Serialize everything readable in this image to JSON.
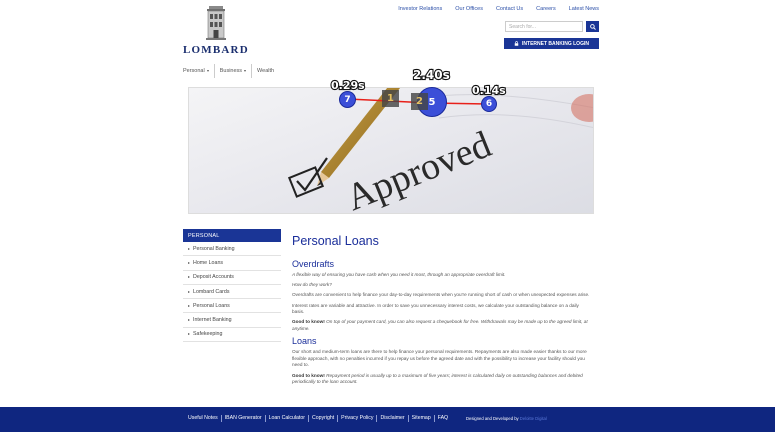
{
  "brand": {
    "logo_text": "LOMBARD"
  },
  "top_links": [
    "Investor Relations",
    "Our Offices",
    "Contact Us",
    "Careers",
    "Latest News"
  ],
  "search": {
    "placeholder": "Search for..."
  },
  "login_button": "INTERNET BANKING LOGIN",
  "main_nav": [
    {
      "label": "Personal",
      "dropdown": true
    },
    {
      "label": "Business",
      "dropdown": true
    },
    {
      "label": "Wealth",
      "dropdown": false
    }
  ],
  "hero": {
    "alt_word": "Approved"
  },
  "overlay": {
    "time_labels": [
      "0.29s",
      "2.40s",
      "0.14s"
    ],
    "marks": [
      "7",
      "1",
      "2",
      "5",
      "6"
    ],
    "line_color": "#e8201a",
    "circle_color": "#3b4fd8"
  },
  "sidebar": {
    "heading": "PERSONAL",
    "items": [
      "Personal Banking",
      "Home Loans",
      "Deposit Accounts",
      "Lombard Cards",
      "Personal Loans",
      "Internet Banking",
      "Safekeeping"
    ]
  },
  "content": {
    "page_title": "Personal Loans",
    "overdrafts": {
      "title": "Overdrafts",
      "intro": "A flexible way of ensuring you have cash when you need it most, through an appropriate overdraft limit.",
      "how": "How do they work?",
      "p1": "Overdrafts are convenient to help finance your day-to-day requirements when you're running short of cash or when unexpected expenses arise.",
      "p2": "Interest rates are variable and attractive.  In order to save you unnecessary interest costs, we calculate your outstanding balance on a daily basis.",
      "gtk_label": "Good to know!",
      "gtk_text": "On top of your payment card, you can also request a chequebook for free.  Withdrawals may be made up to the agreed limit, at anytime."
    },
    "loans": {
      "title": "Loans",
      "p1": "Our short and medium-term loans are there to help finance your personal requirements.  Repayments are also made easier thanks to our more flexible approach, with no penalties incurred if you repay us before the agreed date and with the possibility to increase your facility should you need to.",
      "gtk_label": "Good to know!",
      "gtk_text": "Repayment period is usually up to a maximum of five years; interest is calculated daily on outstanding balances and debited periodically to the loan account."
    }
  },
  "footer": {
    "links": [
      "Useful Notes",
      "IBAN Generator",
      "Loan Calculator",
      "Copyright",
      "Privacy Policy",
      "Disclaimer",
      "Sitemap",
      "FAQ"
    ],
    "credit_prefix": "Designed and Developed by",
    "credit_dev": "Deloitte Digital"
  }
}
